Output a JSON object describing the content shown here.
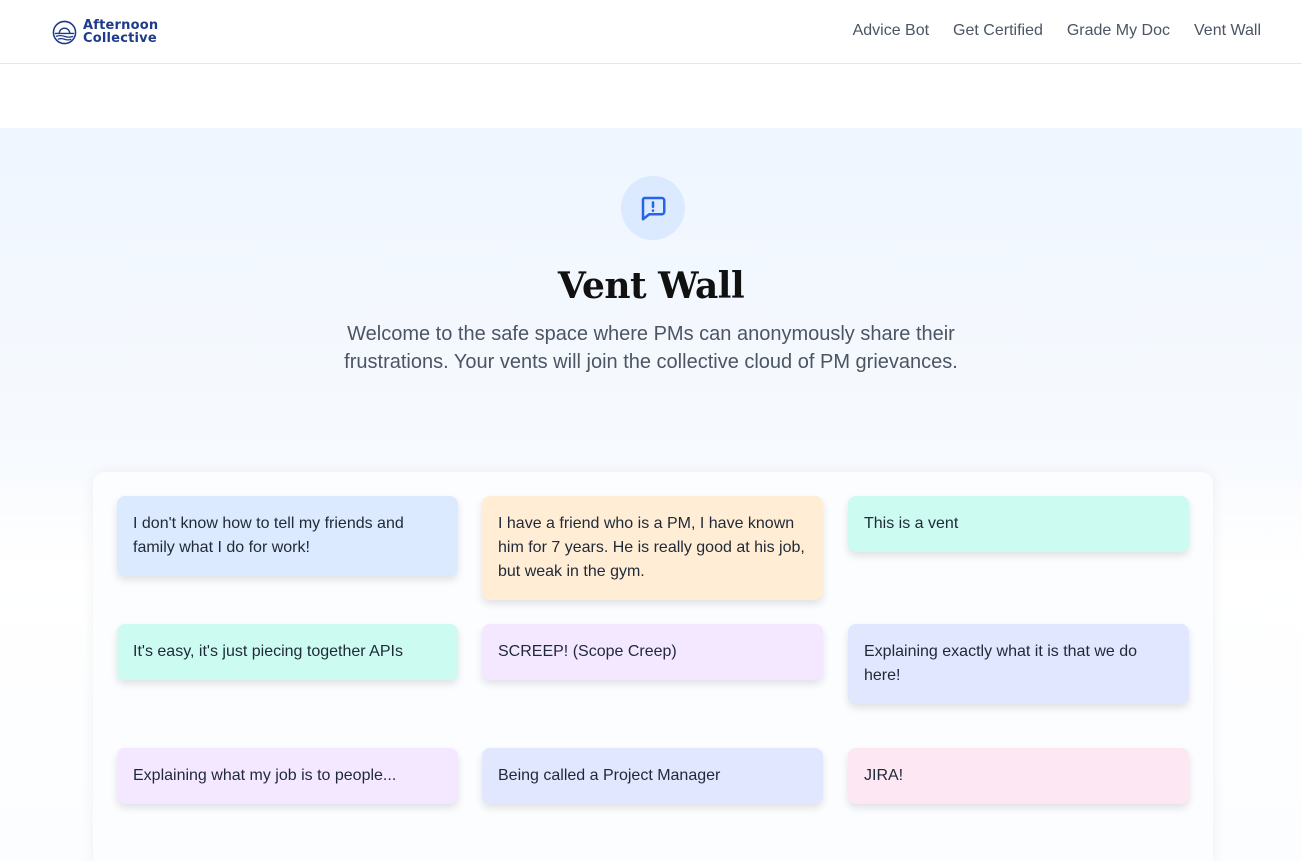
{
  "header": {
    "logo": {
      "line1": "Afternoon",
      "line2": "Collective"
    },
    "nav": [
      {
        "label": "Advice Bot"
      },
      {
        "label": "Get Certified"
      },
      {
        "label": "Grade My Doc"
      },
      {
        "label": "Vent Wall"
      }
    ]
  },
  "hero": {
    "icon": "message-alert-icon",
    "title": "Vent Wall",
    "subtitle": "Welcome to the safe space where PMs can anonymously share their frustrations. Your vents will join the collective cloud of PM grievances."
  },
  "vents": [
    {
      "text": "I don't know how to tell my friends and family what I do for work!",
      "color": "#dbeafe"
    },
    {
      "text": "I have a friend who is a PM, I have known him for 7 years. He is really good at his job, but weak in the gym.",
      "color": "#ffedd5"
    },
    {
      "text": "This is a vent",
      "color": "#ccfbf1"
    },
    {
      "text": "It's easy, it's just piecing together APIs",
      "color": "#ccfbf1"
    },
    {
      "text": "SCREEP! (Scope Creep)",
      "color": "#f3e8ff"
    },
    {
      "text": "Explaining exactly what it is that we do here!",
      "color": "#e0e7ff"
    },
    {
      "text": "Explaining what my job is to people...",
      "color": "#f3e8ff"
    },
    {
      "text": "Being called a Project Manager",
      "color": "#e0e7ff"
    },
    {
      "text": "JIRA!",
      "color": "#fce7f3"
    }
  ],
  "colors": {
    "accent": "#2563eb",
    "brand": "#1e3a8a"
  }
}
